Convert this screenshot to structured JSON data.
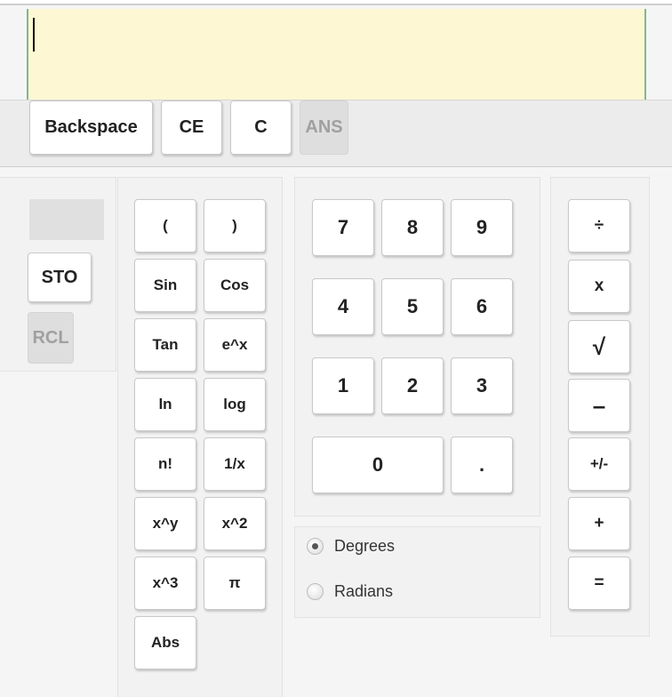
{
  "display": {
    "value": ""
  },
  "toolbar": {
    "backspace": "Backspace",
    "ce": "CE",
    "c": "C",
    "ans": "ANS"
  },
  "memory": {
    "value": "",
    "sto": "STO",
    "rcl": "RCL"
  },
  "functions": {
    "open_paren": "(",
    "close_paren": ")",
    "sin": "Sin",
    "cos": "Cos",
    "tan": "Tan",
    "exp": "e^x",
    "ln": "ln",
    "log": "log",
    "factorial": "n!",
    "reciprocal": "1/x",
    "power": "x^y",
    "square": "x^2",
    "cube": "x^3",
    "pi": "π",
    "abs": "Abs"
  },
  "numpad": {
    "d7": "7",
    "d8": "8",
    "d9": "9",
    "d4": "4",
    "d5": "5",
    "d6": "6",
    "d1": "1",
    "d2": "2",
    "d3": "3",
    "d0": "0",
    "decimal": "."
  },
  "angle_mode": {
    "options": [
      "Degrees",
      "Radians"
    ],
    "selected": "Degrees"
  },
  "operators": {
    "divide": "÷",
    "multiply": "x",
    "sqrt": "√",
    "subtract": "–",
    "negate": "+/-",
    "add": "+",
    "equals": "="
  }
}
